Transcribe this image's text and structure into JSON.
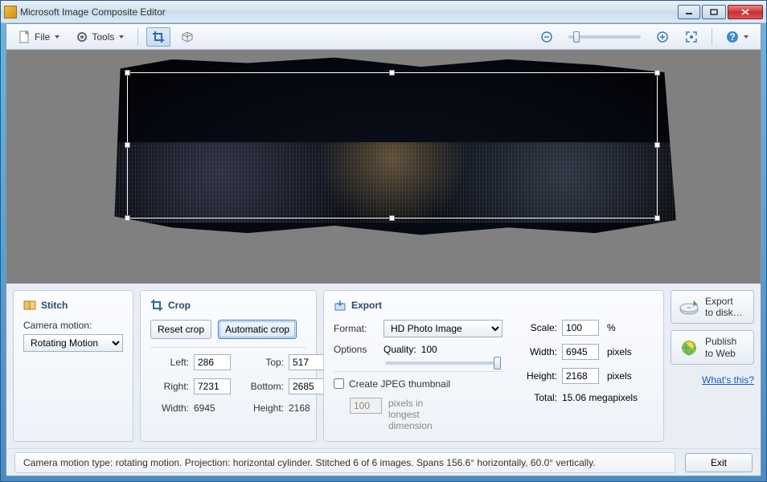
{
  "window": {
    "title": "Microsoft Image Composite Editor"
  },
  "toolbar": {
    "file": "File",
    "tools": "Tools"
  },
  "panels": {
    "stitch": {
      "title": "Stitch",
      "camera_label": "Camera motion:",
      "camera_value": "Rotating Motion"
    },
    "crop": {
      "title": "Crop",
      "reset": "Reset crop",
      "auto": "Automatic crop",
      "left_lbl": "Left:",
      "left": "286",
      "top_lbl": "Top:",
      "top": "517",
      "right_lbl": "Right:",
      "right": "7231",
      "bottom_lbl": "Bottom:",
      "bottom": "2685",
      "width_lbl": "Width:",
      "width": "6945",
      "height_lbl": "Height:",
      "height": "2168"
    },
    "export": {
      "title": "Export",
      "format_lbl": "Format:",
      "format_val": "HD Photo Image",
      "options_lbl": "Options",
      "quality_lbl": "Quality:",
      "quality_val": "100",
      "thumb_chk": "Create JPEG thumbnail",
      "thumb_px": "100",
      "thumb_desc": "pixels in longest dimension",
      "scale_lbl": "Scale:",
      "scale_val": "100",
      "scale_unit": "%",
      "width_lbl": "Width:",
      "width_val": "6945",
      "px": "pixels",
      "height_lbl": "Height:",
      "height_val": "2168",
      "total_lbl": "Total:",
      "total_val": "15.06 megapixels",
      "exp_disk1": "Export",
      "exp_disk2": "to disk…",
      "pub1": "Publish",
      "pub2": "to Web",
      "whats": "What's this?"
    }
  },
  "status": {
    "msg": "Camera motion type: rotating motion. Projection: horizontal cylinder. Stitched 6 of 6 images. Spans 156.6° horizontally, 60.0° vertically.",
    "exit": "Exit"
  }
}
